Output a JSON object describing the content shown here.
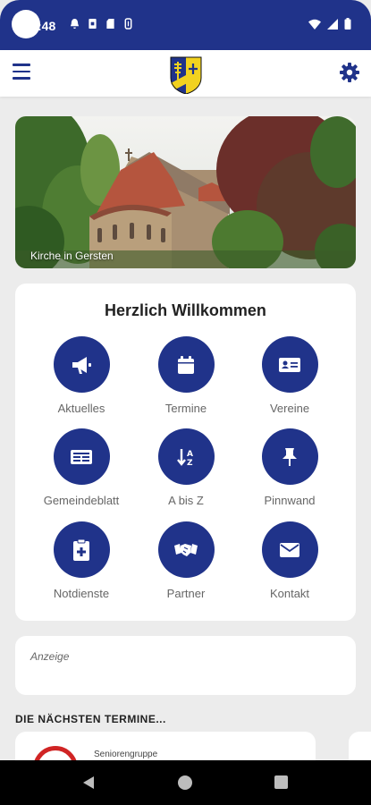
{
  "status_bar": {
    "time": ":48",
    "icons_left": [
      "notification-bell-icon",
      "sim-icon",
      "sd-card-icon",
      "usb-icon"
    ],
    "icons_right": [
      "wifi-icon",
      "signal-icon",
      "battery-icon"
    ]
  },
  "app_bar": {
    "menu_icon": "hamburger-menu-icon",
    "logo": "coat-of-arms-logo",
    "settings_icon": "gear-icon"
  },
  "hero": {
    "caption": "Kirche in Gersten"
  },
  "welcome": {
    "title": "Herzlich Willkommen",
    "tiles": [
      {
        "label": "Aktuelles",
        "icon": "megaphone-icon"
      },
      {
        "label": "Termine",
        "icon": "calendar-icon"
      },
      {
        "label": "Vereine",
        "icon": "id-card-icon"
      },
      {
        "label": "Gemeindeblatt",
        "icon": "newspaper-icon"
      },
      {
        "label": "A bis Z",
        "icon": "sort-alpha-icon"
      },
      {
        "label": "Pinnwand",
        "icon": "pushpin-icon"
      },
      {
        "label": "Notdienste",
        "icon": "medical-clipboard-icon"
      },
      {
        "label": "Partner",
        "icon": "handshake-icon"
      },
      {
        "label": "Kontakt",
        "icon": "envelope-icon"
      }
    ]
  },
  "ad": {
    "label": "Anzeige"
  },
  "events": {
    "section_title": "DIE NÄCHSTEN TERMINE...",
    "items": [
      {
        "label": "Seniorengruppe",
        "icon": "event-logo-icon"
      }
    ]
  },
  "nav_bar": {
    "back_icon": "back-triangle-icon",
    "home_icon": "home-circle-icon",
    "recents_icon": "recents-square-icon"
  },
  "colors": {
    "primary": "#20338a",
    "background": "#ececec",
    "card": "#ffffff",
    "logo_yellow": "#f2d21f"
  }
}
